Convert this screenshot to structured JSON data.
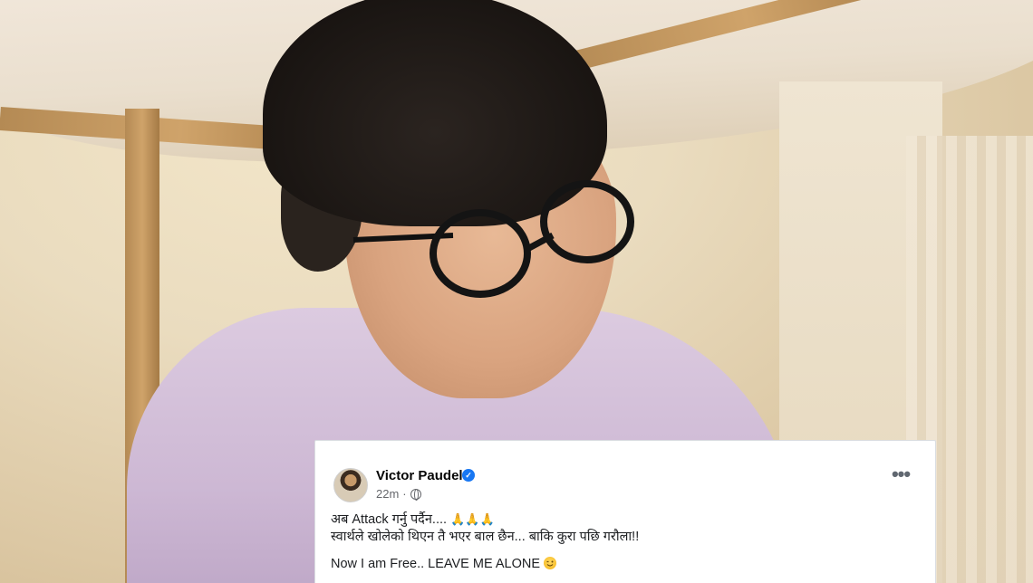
{
  "post": {
    "author_name": "Victor Paudel",
    "time_ago": "22m",
    "dot": "·",
    "more_label": "•••",
    "line1_text": "अब Attack गर्नु पर्दैन....",
    "line1_emoji": "🙏🙏🙏",
    "line2_text": "स्वार्थले खोलेको थिएन तै भएर बाल छैन... बाकि कुरा पछि गरौला!!",
    "line3_text": "Now I am Free.. LEAVE ME ALONE"
  },
  "icons": {
    "verified": "verified-badge-icon",
    "globe": "globe-icon",
    "more": "more-options-icon",
    "wink": "wink-emoji-icon"
  },
  "colors": {
    "facebook_blue": "#1877f2",
    "text_primary": "#050505",
    "text_secondary": "#65676b"
  }
}
